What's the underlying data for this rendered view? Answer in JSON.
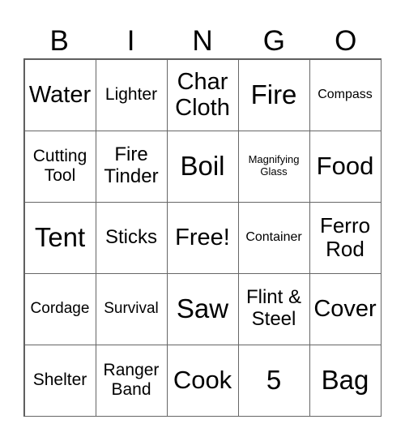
{
  "header": [
    "B",
    "I",
    "N",
    "G",
    "O"
  ],
  "cells": [
    [
      "Water",
      "Lighter",
      "Char Cloth",
      "Fire",
      "Compass"
    ],
    [
      "Cutting Tool",
      "Fire Tinder",
      "Boil",
      "Magnifying Glass",
      "Food"
    ],
    [
      "Tent",
      "Sticks",
      "Free!",
      "Container",
      "Ferro Rod"
    ],
    [
      "Cordage",
      "Survival",
      "Saw",
      "Flint & Steel",
      "Cover"
    ],
    [
      "Shelter",
      "Ranger Band",
      "Cook",
      "5",
      "Bag"
    ]
  ]
}
